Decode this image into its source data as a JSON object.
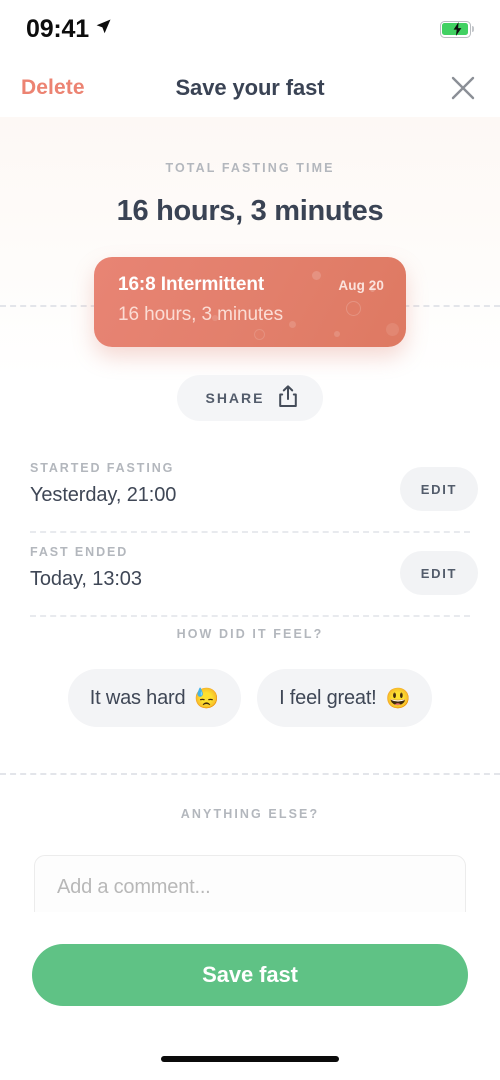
{
  "status_bar": {
    "time": "09:41",
    "location_icon": "navigation-arrow-icon",
    "battery_icon": "battery-charging-icon"
  },
  "nav": {
    "delete_label": "Delete",
    "title": "Save your fast",
    "close_icon": "close-x-icon"
  },
  "hero": {
    "label": "TOTAL FASTING TIME",
    "total": "16 hours, 3 minutes"
  },
  "fast_card": {
    "plan": "16:8 Intermittent",
    "date": "Aug 20",
    "duration": "16 hours, 3 minutes"
  },
  "share": {
    "label": "SHARE",
    "icon": "share-upload-icon"
  },
  "details": [
    {
      "label": "STARTED FASTING",
      "value": "Yesterday, 21:00",
      "edit_label": "EDIT"
    },
    {
      "label": "FAST ENDED",
      "value": "Today, 13:03",
      "edit_label": "EDIT"
    }
  ],
  "feel": {
    "label": "HOW DID IT FEEL?",
    "options": [
      {
        "text": "It was hard",
        "emoji": "😓"
      },
      {
        "text": "I feel great!",
        "emoji": "😃"
      }
    ]
  },
  "comment": {
    "label": "ANYTHING ELSE?",
    "placeholder": "Add a comment...",
    "value": ""
  },
  "footer": {
    "save_label": "Save fast"
  },
  "colors": {
    "accent_salmon": "#e27f6b",
    "delete_red": "#ec8372",
    "save_green": "#5fc285",
    "title_navy": "#3a4354",
    "label_gray": "#b3b7bd",
    "pill_gray": "#f3f4f6",
    "battery_green": "#41d162"
  }
}
